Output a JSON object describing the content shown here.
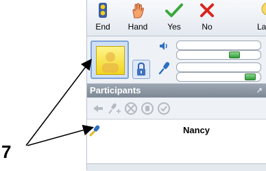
{
  "toolbar": {
    "end_label": "End",
    "hand_label": "Hand",
    "yes_label": "Yes",
    "no_label": "No",
    "partial_label": "La"
  },
  "participants": {
    "header": "Participants",
    "names": [
      "Nancy"
    ]
  },
  "annotation": {
    "number": "7"
  },
  "icons": {
    "end": "traffic-light-icon",
    "hand": "raised-hand-icon",
    "yes": "green-check-icon",
    "no": "red-x-icon",
    "volume": "speaker-icon",
    "mic": "microphone-icon",
    "lock": "lock-icon"
  },
  "colors": {
    "yes": "#3aa83a",
    "no": "#d9231c",
    "header_bg": "#8a95a2",
    "slider_thumb": "#2f9d3a"
  },
  "levels": {
    "volume": 0.72,
    "mic": 0.93
  }
}
